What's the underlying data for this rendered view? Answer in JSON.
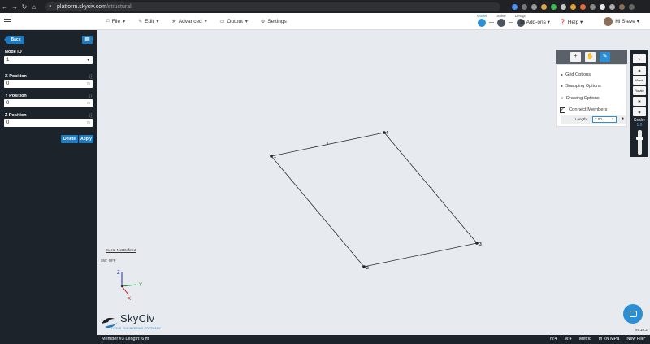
{
  "browser": {
    "url_host": "platform.skyciv.com",
    "url_path": "/structural"
  },
  "toolbar": {
    "menu": [
      {
        "label": "File",
        "icon": "file-icon"
      },
      {
        "label": "Edit",
        "icon": "pencil-icon"
      },
      {
        "label": "Advanced",
        "icon": "wrench-icon"
      },
      {
        "label": "Output",
        "icon": "monitor-icon"
      },
      {
        "label": "Settings",
        "icon": "gear-icon"
      }
    ],
    "steps": [
      "Model",
      "Solve",
      "Design"
    ],
    "addons_label": "Add-ons",
    "help_label": "Help",
    "user_label": "Hi Steve"
  },
  "left_panel": {
    "back_label": "Back",
    "node_id_label": "Node ID",
    "node_id_value": "1",
    "x_label": "X Position",
    "x_value": "0",
    "y_label": "Y Position",
    "y_value": "0",
    "z_label": "Z Position",
    "z_value": "0",
    "unit": "m",
    "delete_label": "Delete",
    "apply_label": "Apply"
  },
  "canvas": {
    "nodes": [
      {
        "label": "1"
      },
      {
        "label": "2"
      },
      {
        "label": "3"
      },
      {
        "label": "4"
      }
    ],
    "members": [
      {
        "label": "1"
      },
      {
        "label": "2"
      },
      {
        "label": "3"
      },
      {
        "label": "4"
      }
    ],
    "sec_label": "Sec1: Not Defined",
    "sw_label": "SW: OFF",
    "axes": {
      "z": "Z",
      "y": "Y",
      "x": "X"
    }
  },
  "options_panel": {
    "grid": "Grid Options",
    "snapping": "Snapping Options",
    "drawing": "Drawing Options",
    "connect_members": "Connect Members",
    "length_label": "Length",
    "length_value": "2.00"
  },
  "vtool": {
    "views": "Views",
    "rotate": "Rotate",
    "scale_label": "Scale:",
    "scale_value": "1.0"
  },
  "logo": {
    "name": "SkyCiv",
    "tagline": "CLOUD ENGINEERING SOFTWARE"
  },
  "version": "v4.10.2",
  "status": {
    "member_info": "Member #3 Length: 6 m",
    "nodes": "N:4",
    "members": "M:4",
    "units_system": "Metric",
    "units": "m  kN  MPa",
    "file": "New File*"
  },
  "colors": {
    "accent": "#2b8fd6",
    "panel": "#1d232b",
    "canvas": "#e7eaee"
  }
}
